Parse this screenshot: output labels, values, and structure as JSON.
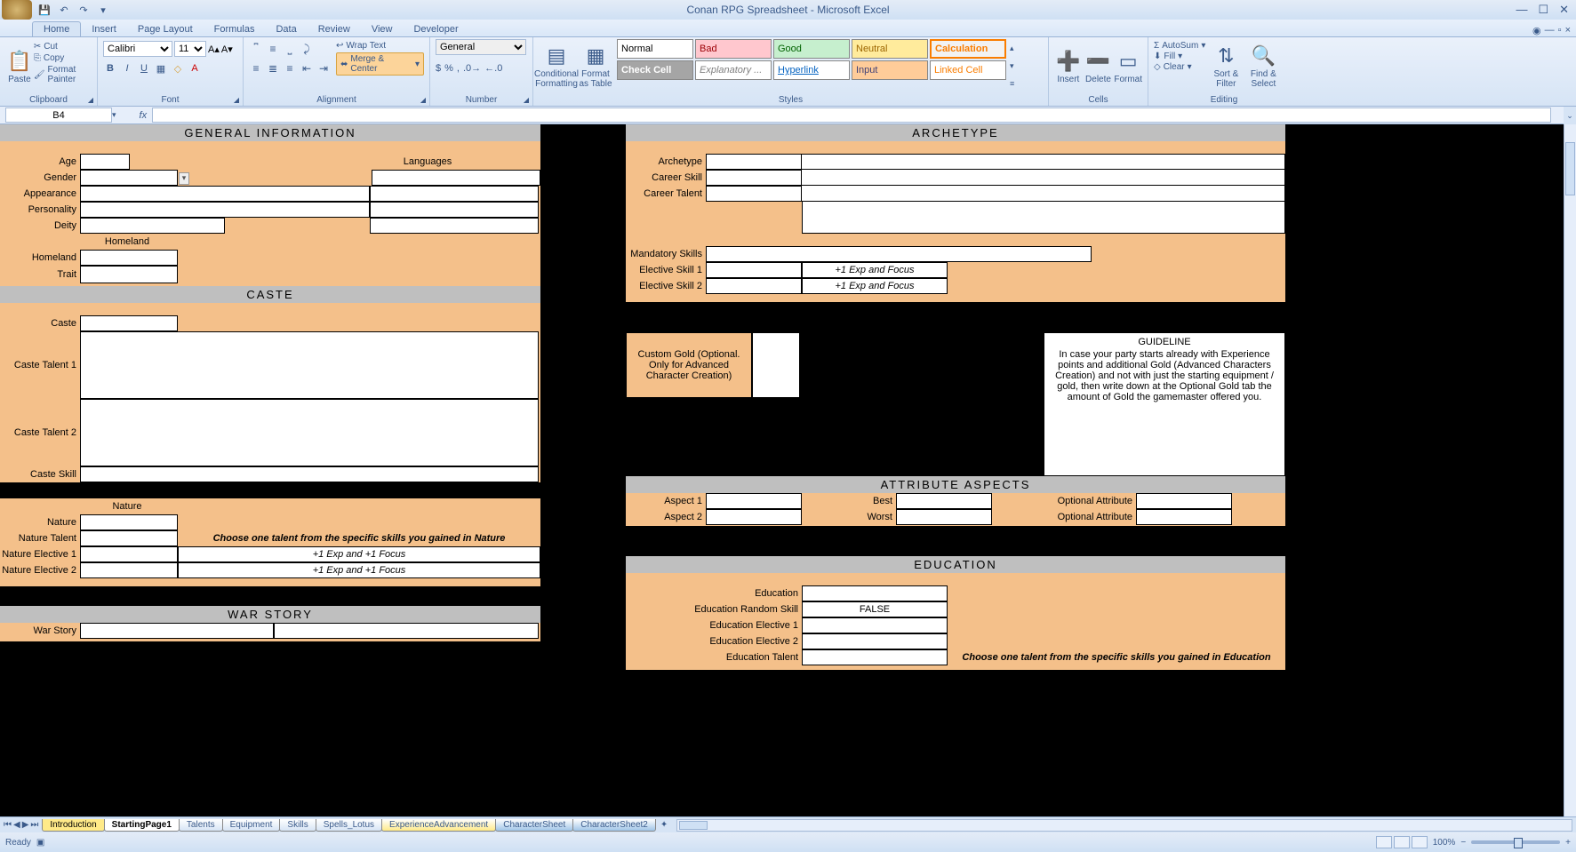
{
  "app": {
    "title": "Conan RPG Spreadsheet - Microsoft Excel"
  },
  "tabs": {
    "home": "Home",
    "insert": "Insert",
    "pagelayout": "Page Layout",
    "formulas": "Formulas",
    "data": "Data",
    "review": "Review",
    "view": "View",
    "developer": "Developer"
  },
  "ribbon": {
    "clipboard": {
      "paste": "Paste",
      "cut": "Cut",
      "copy": "Copy",
      "fmtpainter": "Format Painter",
      "label": "Clipboard"
    },
    "font": {
      "name": "Calibri",
      "size": "11",
      "label": "Font"
    },
    "alignment": {
      "wrap": "Wrap Text",
      "merge": "Merge & Center",
      "label": "Alignment"
    },
    "number": {
      "fmt": "General",
      "label": "Number"
    },
    "styles": {
      "cond": "Conditional Formatting",
      "fmttbl": "Format as Table",
      "normal": "Normal",
      "bad": "Bad",
      "good": "Good",
      "neutral": "Neutral",
      "calc": "Calculation",
      "checkcell": "Check Cell",
      "explan": "Explanatory ...",
      "hyper": "Hyperlink",
      "input": "Input",
      "linked": "Linked Cell",
      "label": "Styles"
    },
    "cells": {
      "insert": "Insert",
      "delete": "Delete",
      "format": "Format",
      "label": "Cells"
    },
    "editing": {
      "autosum": "AutoSum",
      "fill": "Fill",
      "clear": "Clear",
      "sort": "Sort & Filter",
      "find": "Find & Select",
      "label": "Editing"
    }
  },
  "namebox": "B4",
  "sections": {
    "general": "General Information",
    "caste": "Caste",
    "warstory": "War Story",
    "archetype": "Archetype",
    "attributes": "Attribute Aspects",
    "education": "Education"
  },
  "labels": {
    "age": "Age",
    "gender": "Gender",
    "appearance": "Appearance",
    "personality": "Personality",
    "deity": "Deity",
    "languages": "Languages",
    "homeland_hdr": "Homeland",
    "homeland": "Homeland",
    "trait": "Trait",
    "caste": "Caste",
    "ct1": "Caste Talent 1",
    "ct2": "Caste Talent 2",
    "cskill": "Caste Skill",
    "nature_hdr": "Nature",
    "nature": "Nature",
    "ntalent": "Nature Talent",
    "ne1": "Nature Elective 1",
    "ne2": "Nature Elective 2",
    "natnote": "Choose one talent from the specific skills you gained in Nature",
    "expfocus": "+1 Exp and +1 Focus",
    "warstory": "War Story",
    "arch": "Archetype",
    "cskill2": "Career Skill",
    "ctalent": "Career Talent",
    "mand": "Mandatory Skills",
    "es1": "Elective Skill 1",
    "es2": "Elective Skill 2",
    "expf2": "+1 Exp and Focus",
    "customgold": "Custom Gold (Optional. Only for Advanced Character Creation)",
    "guideline_h": "GUIDELINE",
    "guideline": "In case your party starts already with Experience points and additional Gold (Advanced Characters Creation) and not with just the starting equipment / gold, then write down at the Optional Gold tab the amount of Gold the gamemaster offered you.",
    "aspect1": "Aspect 1",
    "aspect2": "Aspect 2",
    "best": "Best",
    "worst": "Worst",
    "optattr": "Optional Attribute",
    "edu": "Education",
    "edurand": "Education Random Skill",
    "ee1": "Education Elective 1",
    "ee2": "Education Elective 2",
    "etalent": "Education Talent",
    "edunote": "Choose one talent from the specific skills you gained in Education",
    "false": "FALSE"
  },
  "sheettabs": {
    "intro": "Introduction",
    "sp1": "StartingPage1",
    "talents": "Talents",
    "equip": "Equipment",
    "skills": "Skills",
    "spells": "Spells_Lotus",
    "exp": "ExperienceAdvancement",
    "cs": "CharacterSheet",
    "cs2": "CharacterSheet2"
  },
  "status": {
    "ready": "Ready",
    "zoom": "100%"
  }
}
